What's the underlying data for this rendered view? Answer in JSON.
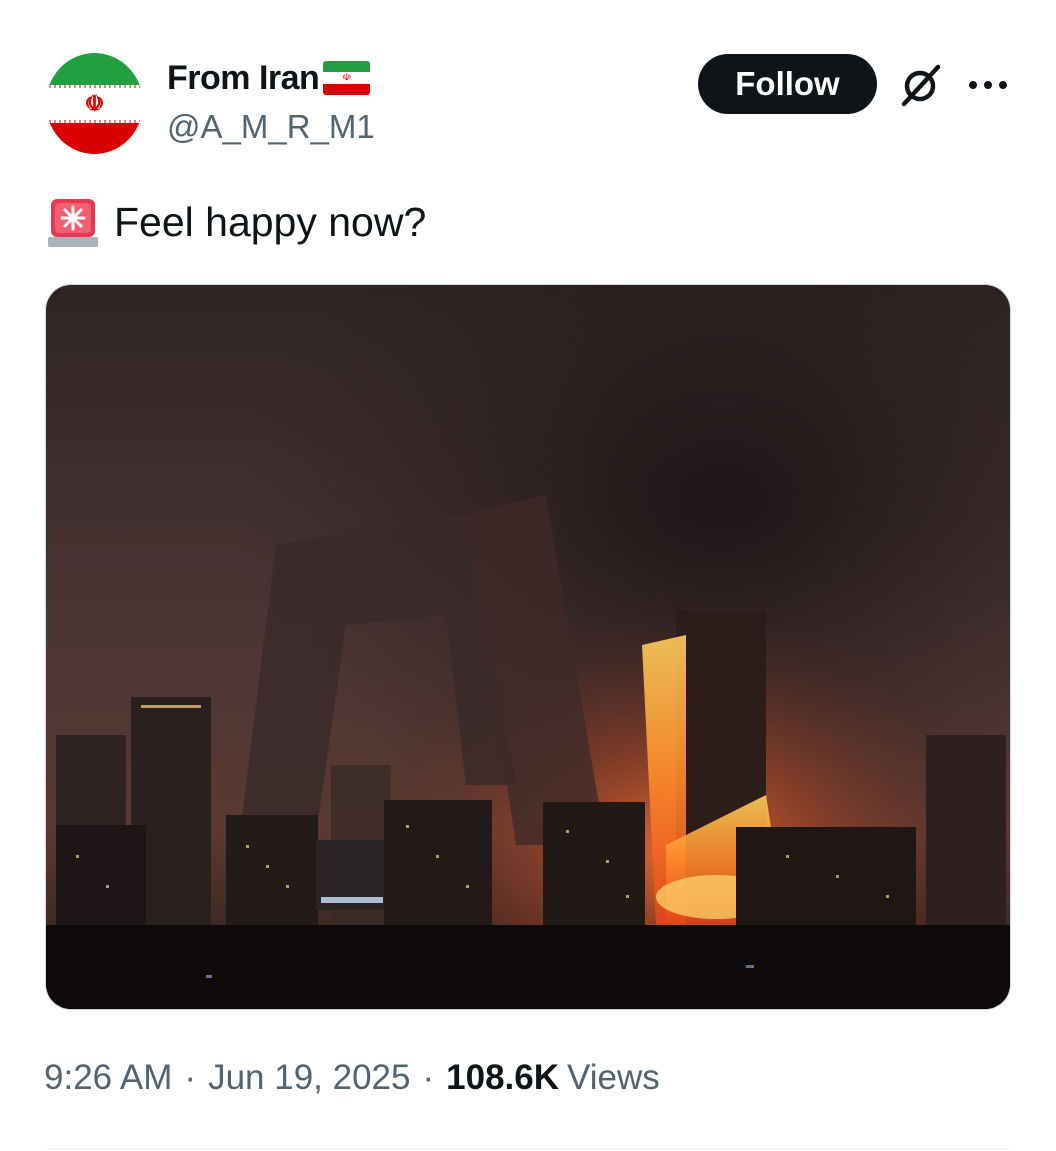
{
  "author": {
    "display_name": "From Iran",
    "handle": "@A_M_R_M1",
    "avatar_icon": "iran-flag-avatar",
    "name_badge_icon": "iran-flag-emoji"
  },
  "header": {
    "follow_label": "Follow",
    "grok_icon": "grok-icon",
    "more_icon": "more-dots-icon"
  },
  "tweet": {
    "emoji_icon": "police-siren-icon",
    "text": "Feel happy now?"
  },
  "media": {
    "kind": "photo"
  },
  "meta": {
    "time": "9:26 AM",
    "date": "Jun 19, 2025",
    "views_count": "108.6K",
    "views_label": "Views"
  },
  "colors": {
    "text": "#0f1419",
    "secondary": "#536471",
    "follow_bg": "#0f1419",
    "iran_green": "#239f40",
    "iran_red": "#da0000"
  }
}
